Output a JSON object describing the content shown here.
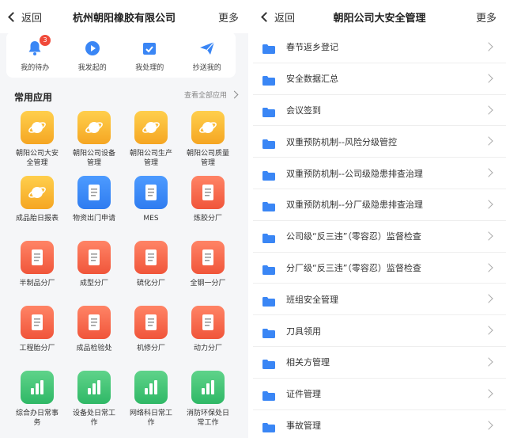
{
  "left": {
    "nav": {
      "back": "返回",
      "title": "杭州朝阳橡胶有限公司",
      "more": "更多"
    },
    "quick": [
      {
        "label": "我的待办",
        "icon": "bell-icon",
        "badge": "3"
      },
      {
        "label": "我发起的",
        "icon": "play-circle-icon"
      },
      {
        "label": "我处理的",
        "icon": "checkbox-icon"
      },
      {
        "label": "抄送我的",
        "icon": "paper-plane-icon"
      }
    ],
    "section": {
      "title": "常用应用",
      "view_all": "查看全部应用"
    },
    "apps": [
      {
        "label": "朝阳公司大安全管理",
        "color": "orange",
        "icon": "planet-icon"
      },
      {
        "label": "朝阳公司设备管理",
        "color": "orange",
        "icon": "planet-icon"
      },
      {
        "label": "朝阳公司生产管理",
        "color": "orange",
        "icon": "planet-icon"
      },
      {
        "label": "朝阳公司质量管理",
        "color": "orange",
        "icon": "planet-icon"
      },
      {
        "label": "成品胎日报表",
        "color": "orange",
        "icon": "planet-icon"
      },
      {
        "label": "物资出门申请",
        "color": "blue",
        "icon": "document-icon"
      },
      {
        "label": "MES",
        "color": "blue",
        "icon": "document-icon"
      },
      {
        "label": "炼胶分厂",
        "color": "red",
        "icon": "document-icon"
      },
      {
        "label": "半制品分厂",
        "color": "red",
        "icon": "document-icon"
      },
      {
        "label": "成型分厂",
        "color": "red",
        "icon": "document-icon"
      },
      {
        "label": "硫化分厂",
        "color": "red",
        "icon": "document-icon"
      },
      {
        "label": "全钢一分厂",
        "color": "red",
        "icon": "document-icon"
      },
      {
        "label": "工程胎分厂",
        "color": "red",
        "icon": "document-icon"
      },
      {
        "label": "成品检验处",
        "color": "red",
        "icon": "document-icon"
      },
      {
        "label": "机修分厂",
        "color": "red",
        "icon": "document-icon"
      },
      {
        "label": "动力分厂",
        "color": "red",
        "icon": "document-icon"
      },
      {
        "label": "综合办日常事务",
        "color": "green",
        "icon": "bar-chart-icon"
      },
      {
        "label": "设备处日常工作",
        "color": "green",
        "icon": "bar-chart-icon"
      },
      {
        "label": "网络科日常工作",
        "color": "green",
        "icon": "bar-chart-icon"
      },
      {
        "label": "消防环保处日常工作",
        "color": "green",
        "icon": "bar-chart-icon"
      }
    ]
  },
  "right": {
    "nav": {
      "back": "返回",
      "title": "朝阳公司大安全管理",
      "more": "更多"
    },
    "items": [
      "春节返乡登记",
      "安全数据汇总",
      "会议签到",
      "双重预防机制--风险分级管控",
      "双重预防机制--公司级隐患排查治理",
      "双重预防机制--分厂级隐患排查治理",
      "公司级“反三违”（零容忍）监督检查",
      "分厂级“反三违”（零容忍）监督检查",
      "班组安全管理",
      "刀具领用",
      "相关方管理",
      "证件管理",
      "事故管理"
    ]
  },
  "colors": {
    "accent": "#2f7cf0",
    "badge": "#f04a3a",
    "folder": "#3a86f5"
  }
}
